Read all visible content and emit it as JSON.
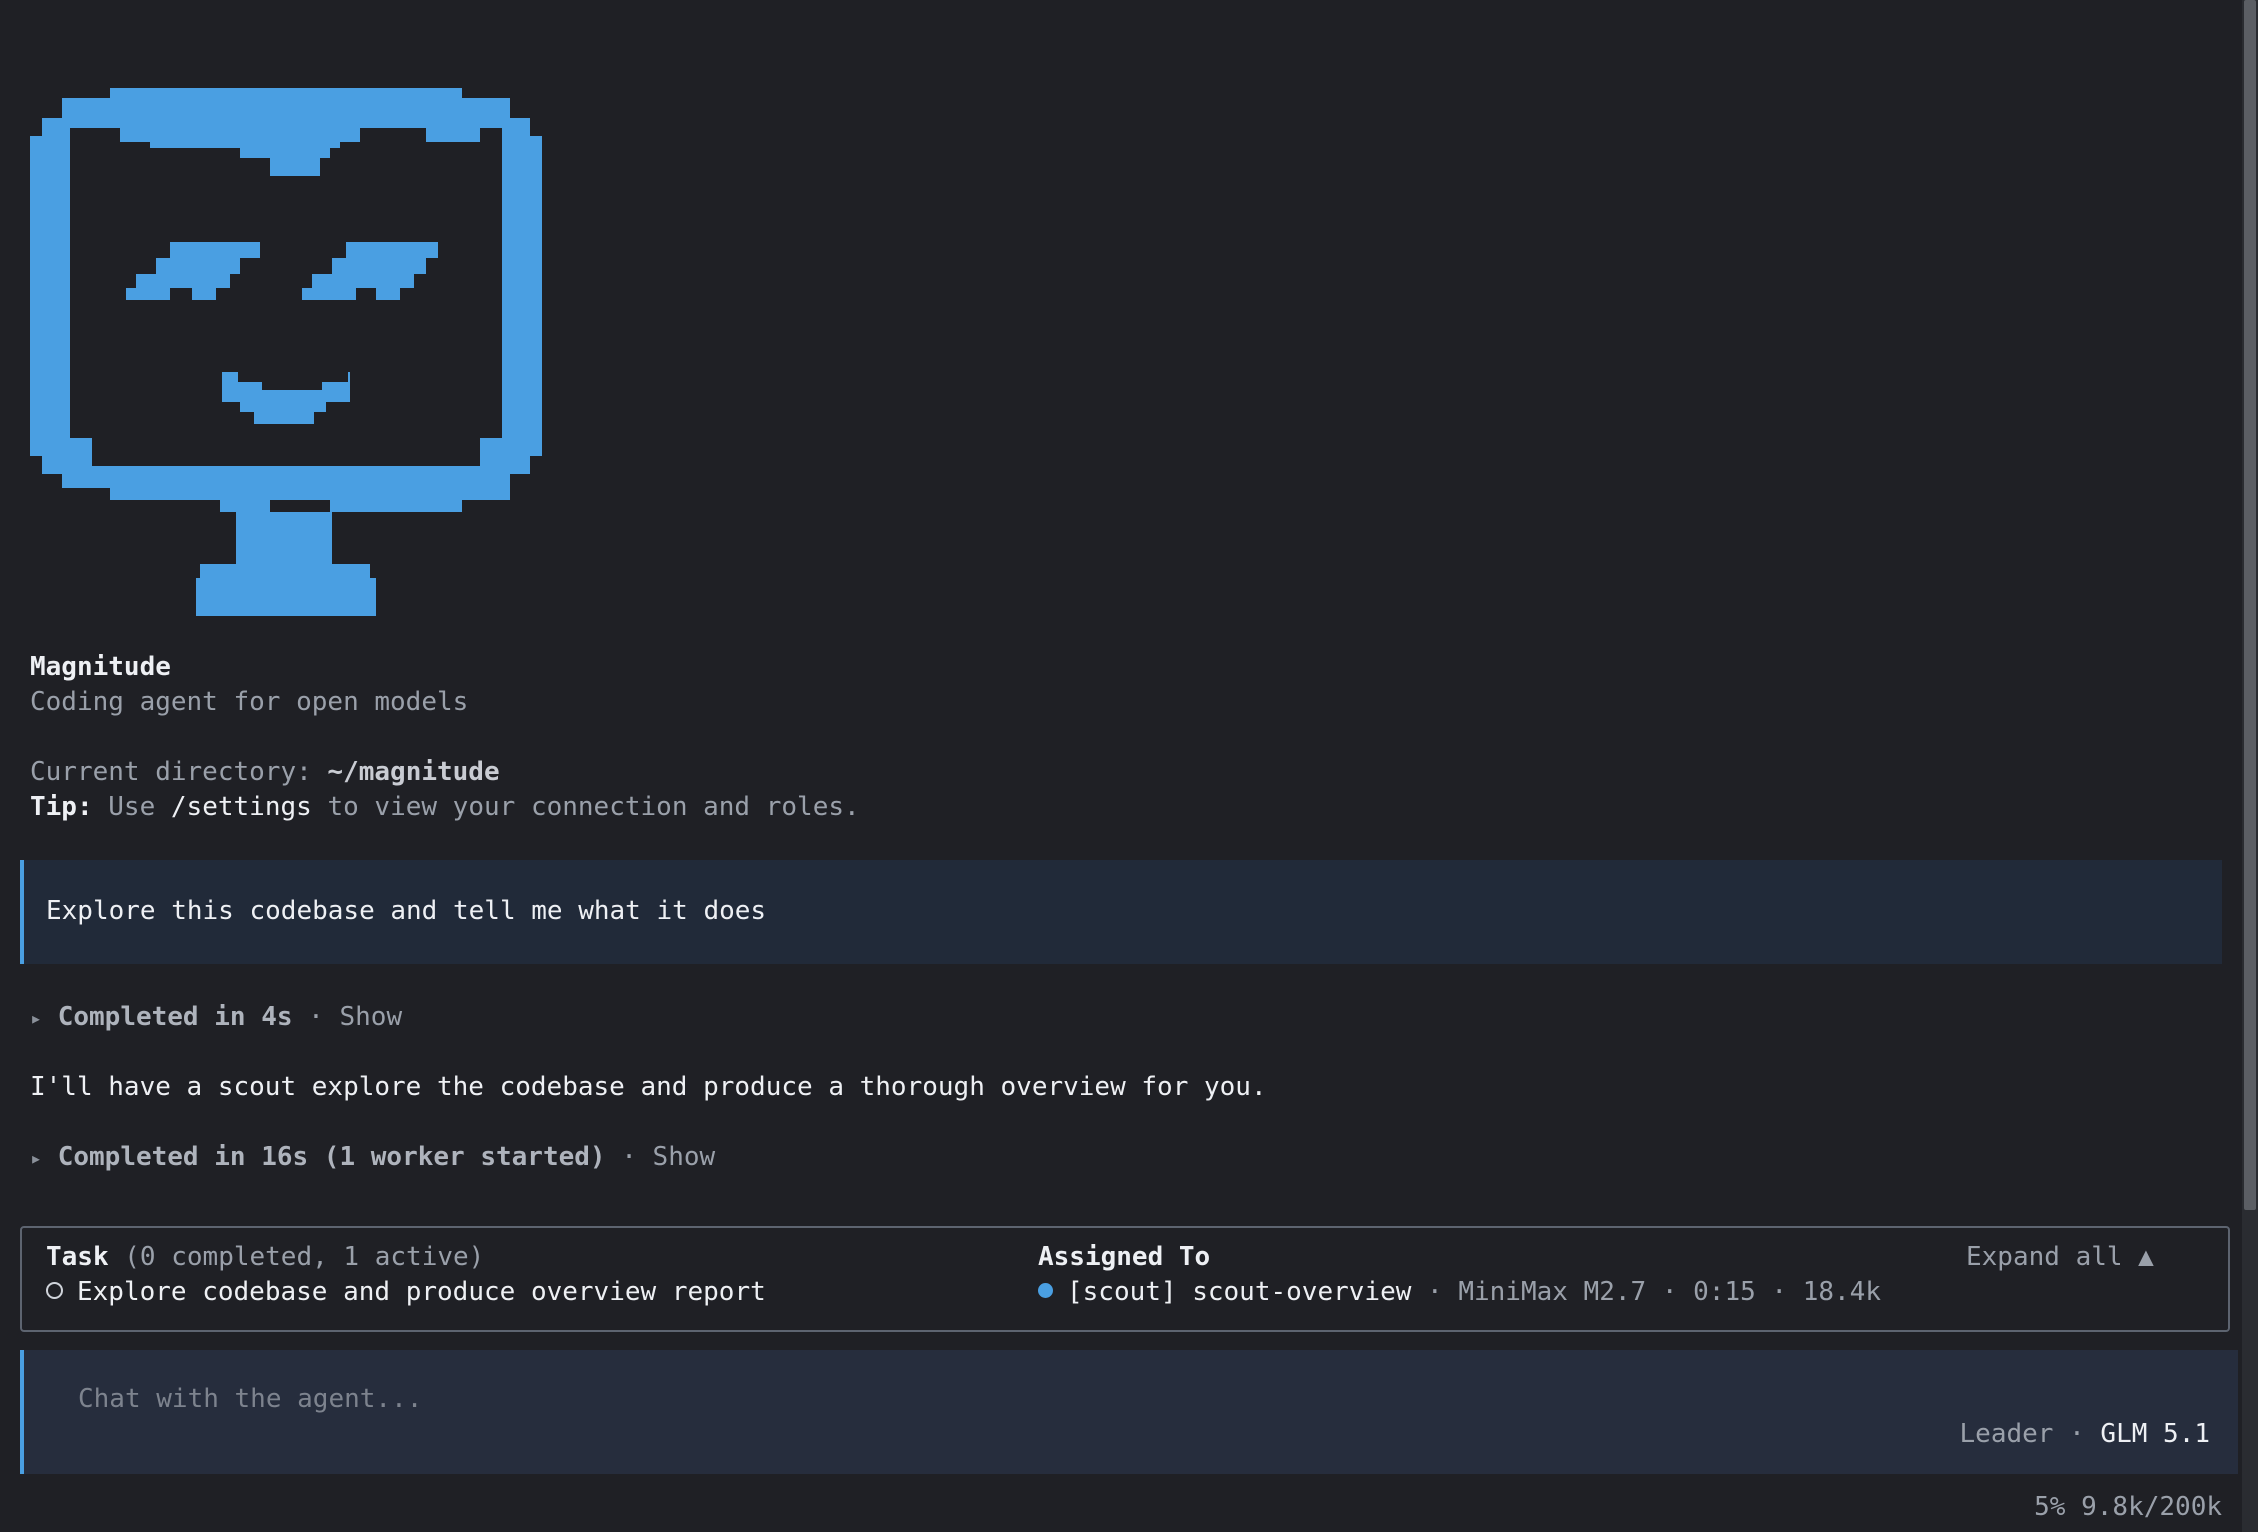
{
  "app": {
    "name": "Magnitude",
    "subtitle": "Coding agent for open models"
  },
  "info": {
    "dir_label": "Current directory: ",
    "dir_value": "~/magnitude",
    "tip_label": "Tip:",
    "tip_pre": " Use ",
    "tip_cmd": "/settings",
    "tip_post": " to view your connection and roles."
  },
  "user_message": "Explore this codebase and tell me what it does",
  "turns": [
    {
      "arrow": "▸",
      "label": "Completed in 4s",
      "sep": " · ",
      "show": "Show"
    },
    {
      "arrow": "▸",
      "label": "Completed in 16s (1 worker started)",
      "sep": " · ",
      "show": "Show"
    }
  ],
  "assistant_message": "I'll have a scout explore the codebase and produce a thorough overview for you.",
  "task_panel": {
    "task_header": "Task",
    "task_counts": " (0 completed, 1 active)",
    "task_item": "Explore codebase and produce overview report",
    "assigned_header": "Assigned To",
    "assignee": "[scout] scout-overview",
    "assignee_meta": " · MiniMax M2.7 · 0:15 · 18.4k",
    "expand_label": "Expand all ▲"
  },
  "input": {
    "placeholder": "Chat with the agent...",
    "role": "Leader · ",
    "model": "GLM 5.1"
  },
  "status": {
    "context_usage": "5% 9.8k/200k"
  },
  "colors": {
    "background": "#1f2025",
    "accent": "#4a9fe2",
    "message_bg": "#212a39",
    "input_bg": "#262d3d"
  }
}
